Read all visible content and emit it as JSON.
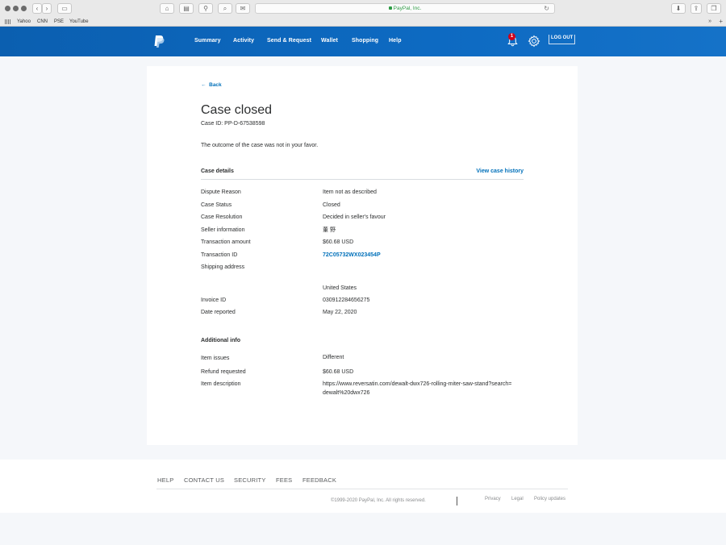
{
  "browser": {
    "url": "PayPal, Inc.",
    "bookmarks": [
      "Yahoo",
      "CNN",
      "PSE",
      "YouTube"
    ],
    "more": "»",
    "plus": "+"
  },
  "nav": {
    "links": [
      "Summary",
      "Activity",
      "Send & Request",
      "Wallet",
      "Shopping",
      "Help"
    ],
    "notification_count": "1",
    "logout": "LOG OUT"
  },
  "page": {
    "back": "Back",
    "title": "Case closed",
    "case_id": "Case ID: PP-D-67538598",
    "outcome": "The outcome of the case was not in your favor.",
    "case_details_title": "Case details",
    "view_history": "View case history",
    "details": [
      {
        "label": "Dispute Reason",
        "value": "Item not as described"
      },
      {
        "label": "Case Status",
        "value": "Closed"
      },
      {
        "label": "Case Resolution",
        "value": "Decided in seller's favour"
      },
      {
        "label": "Seller information",
        "value": "董 野"
      },
      {
        "label": "Transaction amount",
        "value": "$60.68 USD"
      },
      {
        "label": "Transaction ID",
        "value": "72C05732WX023454P"
      },
      {
        "label": "Shipping address",
        "value": ""
      },
      {
        "label": "",
        "value": "United States"
      },
      {
        "label": "Invoice ID",
        "value": "030912284656275"
      },
      {
        "label": "Date reported",
        "value": "May 22, 2020"
      }
    ],
    "additional_title": "Additional info",
    "additional": [
      {
        "label": "Item issues",
        "value": "Different"
      },
      {
        "label": "Refund requested",
        "value": "$60.68 USD"
      },
      {
        "label": "Item description",
        "value": "https://www.reversatin.com/dewalt-dwx726-rolling-miter-saw-stand?search=dewalt%20dwx726"
      }
    ]
  },
  "footer": {
    "links": [
      "HELP",
      "CONTACT US",
      "SECURITY",
      "FEES",
      "FEEDBACK"
    ],
    "copyright": "©1999-2020 PayPal, Inc. All rights reserved.",
    "small_links": [
      "Privacy",
      "Legal",
      "Policy updates"
    ]
  },
  "colors": {
    "nav_blue": "#0d6ac2",
    "link_blue": "#0070ba",
    "badge_red": "#d0021b",
    "secure_green": "#2e9b45"
  }
}
